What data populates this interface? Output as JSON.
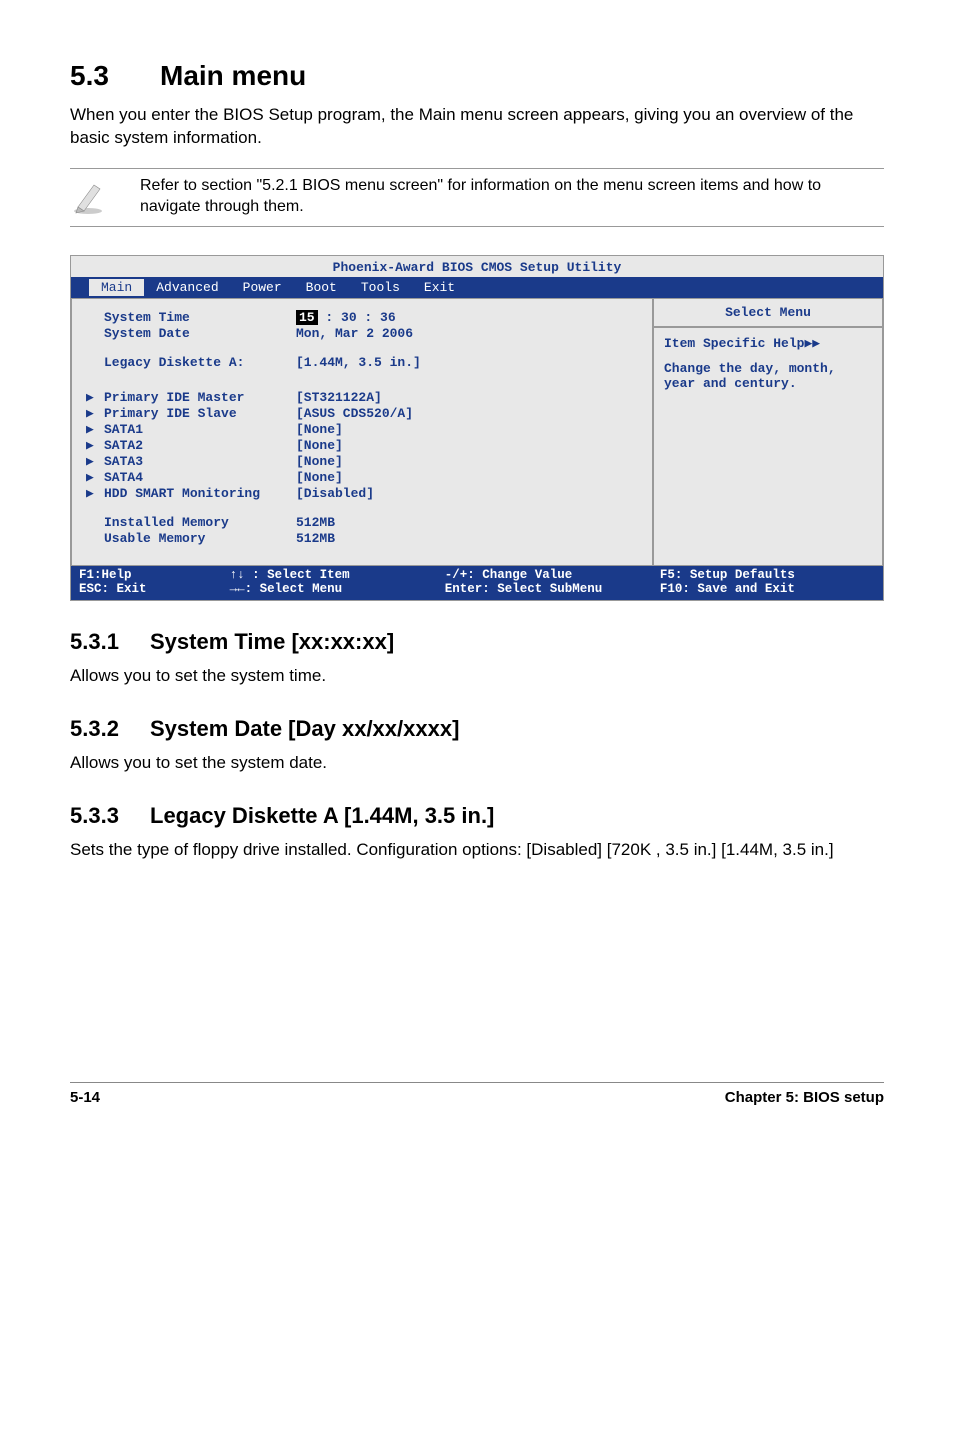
{
  "heading": {
    "num": "5.3",
    "title": "Main menu"
  },
  "intro": "When you enter the BIOS Setup program, the Main menu screen appears, giving you an overview of the basic system information.",
  "note": "Refer to section \"5.2.1  BIOS menu screen\" for information on the menu screen items and how to navigate through them.",
  "bios": {
    "title": "Phoenix-Award BIOS CMOS Setup Utility",
    "tabs": [
      "Main",
      "Advanced",
      "Power",
      "Boot",
      "Tools",
      "Exit"
    ],
    "active_tab": "Main",
    "rows": {
      "system_time": {
        "label": "System Time",
        "hh": "15",
        "rest": " : 30 : 36"
      },
      "system_date": {
        "label": "System Date",
        "value": "Mon, Mar 2  2006"
      },
      "legacy": {
        "label": "Legacy Diskette A:",
        "value": "[1.44M, 3.5 in.]"
      },
      "pim": {
        "label": "Primary IDE Master",
        "value": "[ST321122A]"
      },
      "pis": {
        "label": "Primary IDE Slave",
        "value": "[ASUS CDS520/A]"
      },
      "sata1": {
        "label": "SATA1",
        "value": "[None]"
      },
      "sata2": {
        "label": "SATA2",
        "value": "[None]"
      },
      "sata3": {
        "label": "SATA3",
        "value": "[None]"
      },
      "sata4": {
        "label": "SATA4",
        "value": "[None]"
      },
      "hdd": {
        "label": "HDD SMART Monitoring",
        "value": "[Disabled]"
      },
      "inst": {
        "label": "Installed Memory",
        "value": "512MB"
      },
      "usable": {
        "label": "Usable Memory",
        "value": "512MB"
      }
    },
    "help": {
      "title": "Select Menu",
      "line1": "Item Specific Help",
      "line2": "Change the day, month, year and century."
    },
    "footer": {
      "c1a": "F1:Help",
      "c1b": "ESC: Exit",
      "c2a": "↑↓ : Select Item",
      "c2b": "→←: Select Menu",
      "c3a": "-/+: Change Value",
      "c3b": "Enter: Select SubMenu",
      "c4a": "F5: Setup Defaults",
      "c4b": "F10: Save and Exit"
    }
  },
  "sections": {
    "s1": {
      "num": "5.3.1",
      "title": "System Time [xx:xx:xx]",
      "text": "Allows you to set the system time."
    },
    "s2": {
      "num": "5.3.2",
      "title": "System Date [Day xx/xx/xxxx]",
      "text": "Allows you to set the system date."
    },
    "s3": {
      "num": "5.3.3",
      "title": "Legacy Diskette A [1.44M, 3.5 in.]",
      "text": "Sets the type of floppy drive installed. Configuration options: [Disabled] [720K , 3.5 in.] [1.44M, 3.5 in.]"
    }
  },
  "footer": {
    "left": "5-14",
    "right": "Chapter 5: BIOS setup"
  }
}
